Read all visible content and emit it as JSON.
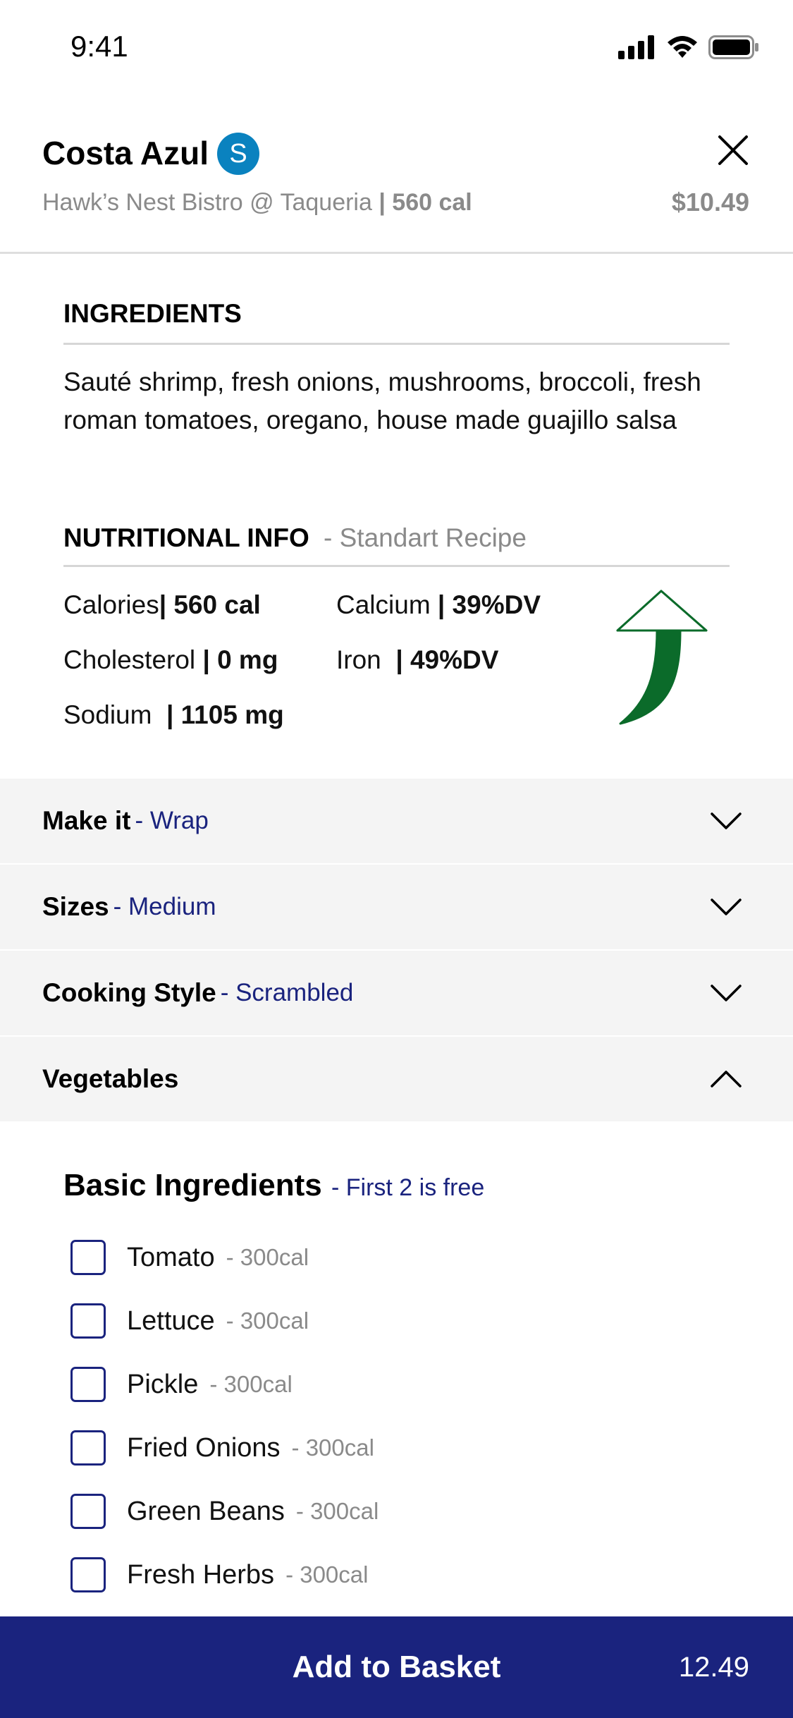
{
  "status": {
    "time": "9:41"
  },
  "header": {
    "title": "Costa Azul",
    "badge": "S",
    "location": "Hawk’s Nest Bistro @ Taqueria",
    "calories": "| 560 cal",
    "price": "$10.49"
  },
  "ingredients": {
    "heading": "INGREDIENTS",
    "text": "Sauté shrimp, fresh onions, mushrooms, broccoli, fresh roman tomatoes, oregano, house made guajillo salsa"
  },
  "nutrition": {
    "heading": "NUTRITIONAL INFO",
    "subheading": "- Standart Recipe",
    "calories_label": "Calories",
    "calories_value": "| 560 cal",
    "cholesterol_label": "Cholesterol",
    "cholesterol_value": "| 0 mg",
    "sodium_label": "Sodium",
    "sodium_value": "| 1105 mg",
    "calcium_label": "Calcium",
    "calcium_value": "|  39%DV",
    "iron_label": "Iron",
    "iron_value": "|  49%DV"
  },
  "options": [
    {
      "label": "Make it",
      "value": "- Wrap",
      "icon": "chevron-down-icon"
    },
    {
      "label": "Sizes",
      "value": "- Medium",
      "icon": "chevron-down-icon"
    },
    {
      "label": "Cooking Style",
      "value": "- Scrambled",
      "icon": "chevron-down-icon"
    },
    {
      "label": "Vegetables",
      "value": "",
      "icon": "chevron-up-icon"
    }
  ],
  "basic": {
    "title": "Basic Ingredients",
    "note": "- First 2 is free",
    "items": [
      {
        "label": "Tomato",
        "cal": "- 300cal"
      },
      {
        "label": "Lettuce",
        "cal": "- 300cal"
      },
      {
        "label": "Pickle",
        "cal": "- 300cal"
      },
      {
        "label": "Fried Onions",
        "cal": "- 300cal"
      },
      {
        "label": "Green Beans",
        "cal": "- 300cal"
      },
      {
        "label": "Fresh Herbs",
        "cal": "- 300cal"
      }
    ]
  },
  "footer": {
    "button": "Add to Basket",
    "total": "12.49"
  },
  "colors": {
    "brand": "#1a237e",
    "badge": "#0a82bf",
    "arrow": "#0b6b2a"
  }
}
